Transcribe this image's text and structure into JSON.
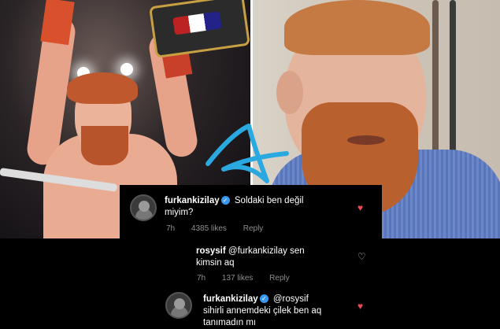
{
  "comments": [
    {
      "username": "furkankizilay",
      "verified": true,
      "text_line1": "Soldaki ben değil",
      "text_line2": "miyim?",
      "time": "7h",
      "likes": "4385 likes",
      "reply": "Reply",
      "liked": true
    },
    {
      "username": "rosysif",
      "verified": false,
      "text_line1": "@furkankizilay sen",
      "text_line2": "kimsin aq",
      "time": "7h",
      "likes": "137 likes",
      "reply": "Reply",
      "liked": false
    },
    {
      "username": "furkankizilay",
      "verified": true,
      "text_line1": "@rosysif",
      "text_line2": "sihirli annemdeki çilek ben aq",
      "text_line3": "tanımadın mı",
      "liked": true
    }
  ],
  "icons": {
    "verified": "verified-badge-icon",
    "heart": "heart-icon",
    "watermark": "a-logo-icon"
  },
  "colors": {
    "background": "#000000",
    "verified": "#3897f0",
    "heart_liked": "#ed4956",
    "meta_text": "#8e8e8e",
    "watermark": "#2aa8e0"
  }
}
